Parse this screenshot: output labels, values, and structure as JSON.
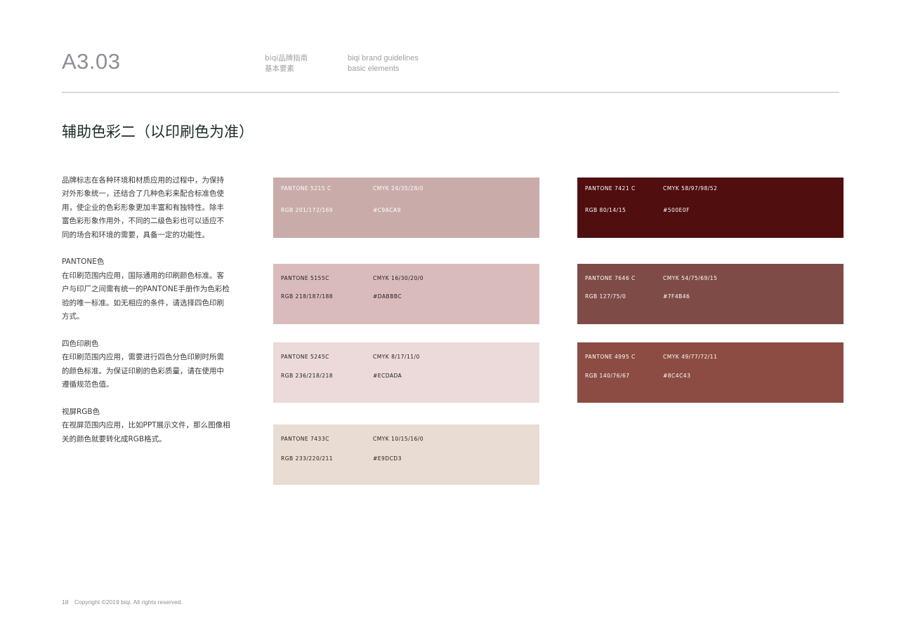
{
  "header": {
    "section_code": "A3.03",
    "cn_line1": "biqi品牌指南",
    "cn_line2": "基本要素",
    "en_line1": "biqi brand guidelines",
    "en_line2": "basic elements"
  },
  "page_title": "辅助色彩二（以印刷色为准）",
  "intro": {
    "paragraph": "品牌标志在各种环境和材质应用的过程中，为保持对外形象统一，还结合了几种色彩来配合标准色使用，使企业的色彩形象更加丰富和有独特性。除丰富色彩形象作用外，不同的二级色彩也可以适应不同的场合和环境的需要，具备一定的功能性。",
    "pantone_label": "PANTONE色",
    "pantone_text": "在印刷范围内应用，国际通用的印刷颜色标准。客户与印厂之间需有统一的PANTONE手册作为色彩检验的唯一标准。如无相应的条件，请选择四色印刷方式。",
    "cmyk_label": "四色印刷色",
    "cmyk_text": "在印刷范围内应用，需要进行四色分色印刷时所需的颜色标准。为保证印刷的色彩质量，请在使用中遵循规范色值。",
    "rgb_label": "视屏RGB色",
    "rgb_text": "在视屏范围内应用，比如PPT展示文件，那么图像相关的颜色就要转化成RGB格式。"
  },
  "swatches": [
    {
      "pantone": "PANTONE 5215 C",
      "cmyk": "CMYK 24/35/28/0",
      "rgb": "RGB 201/172/169",
      "hex": "#C9ACA9",
      "color": "#C9ACA9",
      "text_color": "#ffffff"
    },
    {
      "pantone": "PANTONE 5155C",
      "cmyk": "CMYK 16/30/20/0",
      "rgb": "RGB 218/187/188",
      "hex": "#DABBBC",
      "color": "#DABBBC",
      "text_color": "#1e1e1e"
    },
    {
      "pantone": "PANTONE 5245C",
      "cmyk": "CMYK 8/17/11/0",
      "rgb": "RGB 236/218/218",
      "hex": "#ECDADA",
      "color": "#ECDADA",
      "text_color": "#1e1e1e"
    },
    {
      "pantone": "PANTONE 7433C",
      "cmyk": "CMYK 10/15/16/0",
      "rgb": "RGB 233/220/211",
      "hex": "#E9DCD3",
      "color": "#E9DCD3",
      "text_color": "#1e1e1e"
    },
    {
      "pantone": "PANTONE 7421 C",
      "cmyk": "CMYK 58/97/98/52",
      "rgb": "RGB 80/14/15",
      "hex": "#500E0F",
      "color": "#500E0F",
      "text_color": "#ffffff"
    },
    {
      "pantone": "PANTONE 7646 C",
      "cmyk": "CMYK 54/75/69/15",
      "rgb": "RGB 127/75/0",
      "hex": "#7F4B46",
      "color": "#7F4B46",
      "text_color": "#ffffff"
    },
    {
      "pantone": "PANTONE 4995 C",
      "cmyk": "CMYK 49/77/72/11",
      "rgb": "RGB 140/76/67",
      "hex": "#8C4C43",
      "color": "#8C4C43",
      "text_color": "#ffffff"
    }
  ],
  "footer": {
    "page_number": "18",
    "copyright": "Copyright ©2019 biqi. All rights reserved."
  }
}
